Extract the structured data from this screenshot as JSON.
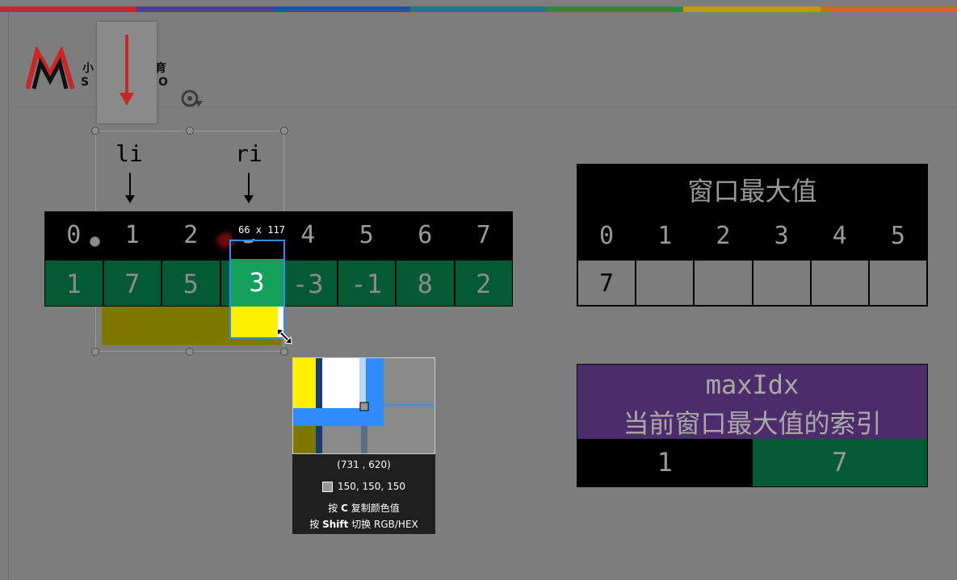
{
  "colors": {
    "rainbow": [
      "#c22828",
      "#4b3f9c",
      "#1a56a8",
      "#1e7a8a",
      "#2d8a3e",
      "#c69410",
      "#d46a14"
    ],
    "highlight_green": "#12a05a",
    "value_green": "#045a32",
    "purple": "#4d2c6b",
    "yellow": "#ffef00",
    "olive": "#7f7800",
    "selection_blue": "#2f8cff"
  },
  "logo": {
    "chars_top": "小",
    "chars_top_right": "育",
    "chars_bottom_left": "S",
    "chars_bottom_right": "O"
  },
  "pointers": {
    "left": "li",
    "right": "ri"
  },
  "array": {
    "indices": [
      "0",
      "1",
      "2",
      "3",
      "4",
      "5",
      "6",
      "7"
    ],
    "values": [
      "1",
      "7",
      "5",
      "3",
      "-3",
      "-1",
      "8",
      "2"
    ],
    "highlight_value": "3"
  },
  "capture": {
    "dimensions": "66 x 117",
    "coordinates": "(731 , 620)",
    "rgb": "150, 150, 150",
    "hint_copy_prefix": "按",
    "hint_copy_key": "C",
    "hint_copy_suffix": "复制颜色值",
    "hint_toggle_prefix": "按",
    "hint_toggle_key": "Shift",
    "hint_toggle_suffix": "切换 RGB/HEX"
  },
  "window_max": {
    "title": "窗口最大值",
    "indices": [
      "0",
      "1",
      "2",
      "3",
      "4",
      "5"
    ],
    "values": [
      "7",
      "",
      "",
      "",
      "",
      ""
    ]
  },
  "max_idx": {
    "name": "maxIdx",
    "description": "当前窗口最大值的索引",
    "left_value": "1",
    "right_value": "7"
  }
}
